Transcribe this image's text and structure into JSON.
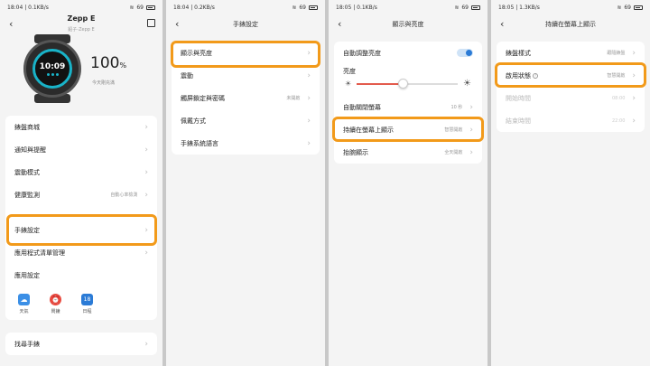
{
  "colors": {
    "highlight": "#f29a1a",
    "accent": "#2b7bd6",
    "slider": "#e35b4d"
  },
  "screens": [
    {
      "status": {
        "time": "18:04",
        "speed": "0.1KB/s",
        "battery": "69"
      },
      "device": {
        "name": "Zepp E",
        "sub": "鉛子-Zepp E",
        "battery": "100",
        "battery_unit": "%",
        "battery_label": "今天剛充滿",
        "watch_time": "10:09"
      },
      "items": [
        {
          "label": "錶盤商城"
        },
        {
          "label": "通知與提醒"
        },
        {
          "label": "震動模式"
        },
        {
          "label": "健康監測",
          "value": "自動心率檢測"
        },
        {
          "label": "手錶設定"
        },
        {
          "label": "應用程式清單管理"
        },
        {
          "label": "應用設定"
        }
      ],
      "shortcuts": [
        {
          "label": "天氣",
          "icon": "cloud-icon",
          "color": "#3b8fe6"
        },
        {
          "label": "鬧鐘",
          "icon": "alarm-clock-icon",
          "color": "#e94a3f"
        },
        {
          "label": "日程",
          "icon": "calendar-icon",
          "color": "#2b7bd6",
          "day": "18"
        }
      ],
      "find": {
        "label": "找尋手錶"
      }
    },
    {
      "status": {
        "time": "18:04",
        "speed": "0.2KB/s",
        "battery": "69"
      },
      "title": "手錶設定",
      "items": [
        {
          "label": "顯示與亮度"
        },
        {
          "label": "震動"
        },
        {
          "label": "觸屏鎖定與密碼",
          "value": "未開啟"
        },
        {
          "label": "佩戴方式"
        },
        {
          "label": "手錶系統語言"
        }
      ]
    },
    {
      "status": {
        "time": "18:05",
        "speed": "0.1KB/s",
        "battery": "69"
      },
      "title": "顯示與亮度",
      "auto_brightness": {
        "label": "自動調整亮度",
        "on": true
      },
      "brightness": {
        "label": "亮度",
        "level": 0.45
      },
      "items": [
        {
          "label": "自動關閉螢幕",
          "value": "10 秒"
        },
        {
          "label": "持續在螢幕上顯示",
          "value": "智慧開啟"
        },
        {
          "label": "抬腕顯示",
          "value": "全天開啟"
        }
      ]
    },
    {
      "status": {
        "time": "18:05",
        "speed": "1.3KB/s",
        "battery": "69"
      },
      "title": "持續在螢幕上顯示",
      "items": [
        {
          "label": "錶盤樣式",
          "value": "跟隨錶盤"
        },
        {
          "label": "啟用狀態",
          "value": "智慧開啟",
          "info": "?"
        },
        {
          "label": "開始時間",
          "value": "08:00",
          "disabled": true
        },
        {
          "label": "結束時間",
          "value": "22:00",
          "disabled": true
        }
      ]
    }
  ]
}
